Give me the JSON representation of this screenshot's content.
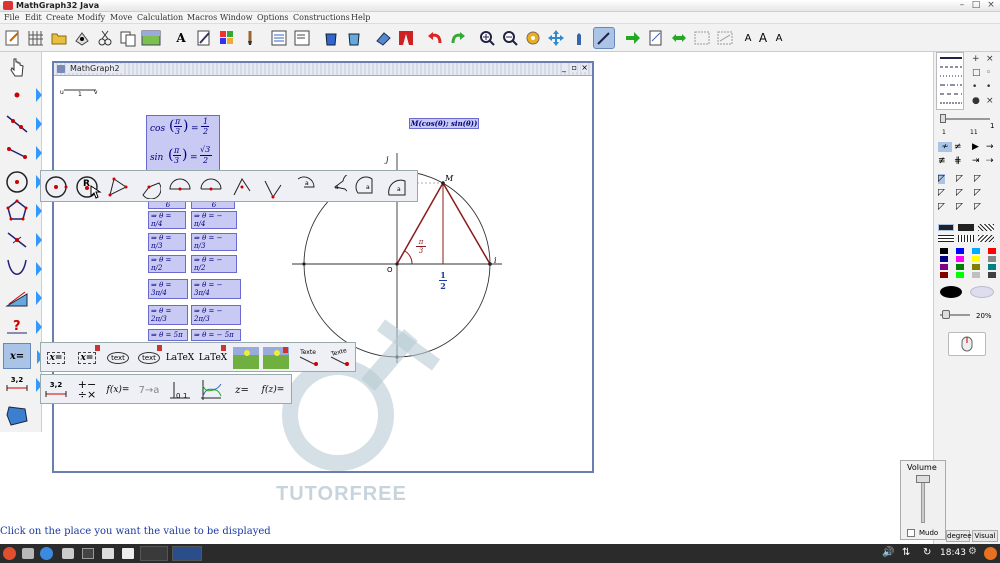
{
  "window": {
    "title": "MathGraph32 Java"
  },
  "menu": [
    "File",
    "Edit",
    "Create",
    "Modify",
    "Move",
    "Calculation",
    "Macros",
    "Window",
    "Options",
    "Constructions",
    "Help"
  ],
  "document": {
    "title": "MathGraph2",
    "ruler": {
      "left": "u",
      "one": "1",
      "right": "v"
    },
    "formulas": {
      "cos_fn": "cos",
      "sin_fn": "sin",
      "pi": "π",
      "three": "3",
      "one": "1",
      "two": "2",
      "eq": "=",
      "sqrt3": "√3"
    },
    "equations": [
      "⇒ θ = π/4",
      "⇒ θ = − π/4",
      "⇒ θ = π/3",
      "⇒ θ = − π/3",
      "⇒ θ = π/2",
      "⇒ θ = − π/2",
      "⇒ θ = 3π/4",
      "⇒ θ = − 3π/4",
      "⇒ θ = 2π/3",
      "⇒ θ = − 2π/3",
      "⇒ θ = 5π",
      "⇒ θ = − 5π"
    ],
    "partial_six": "6",
    "m_label": "M(cos(θ); sin(θ))",
    "point_M": "M",
    "origin": "O",
    "vec_i": "i",
    "vec_j": "j",
    "angle_num": "π",
    "angle_den": "3",
    "half_num": "1",
    "half_den": "2"
  },
  "popup_text": {
    "texte1": "Texte",
    "texte2": "Texte",
    "xeq": "x=",
    "latex": "LaTeX",
    "val32": "3,2",
    "fx": "f(x)=",
    "seven_a": "7→a",
    "zeq": "z=",
    "fz": "f(z)=",
    "text": "text"
  },
  "right_panel": {
    "line_min": "1",
    "line_max": "11",
    "line_value": "1",
    "zoom": "20%"
  },
  "volume": {
    "label": "Volume",
    "mute": "Mudo"
  },
  "bottom_buttons": [
    "degree",
    "Visual"
  ],
  "status": "Click on the place you want the value to be displayed",
  "clock": "18:43",
  "watermark": "TUTORFREE",
  "colors": {
    "accent": "#3399ff",
    "triangle": "#8b1a1a",
    "formula_bg": "#c8caf4"
  }
}
